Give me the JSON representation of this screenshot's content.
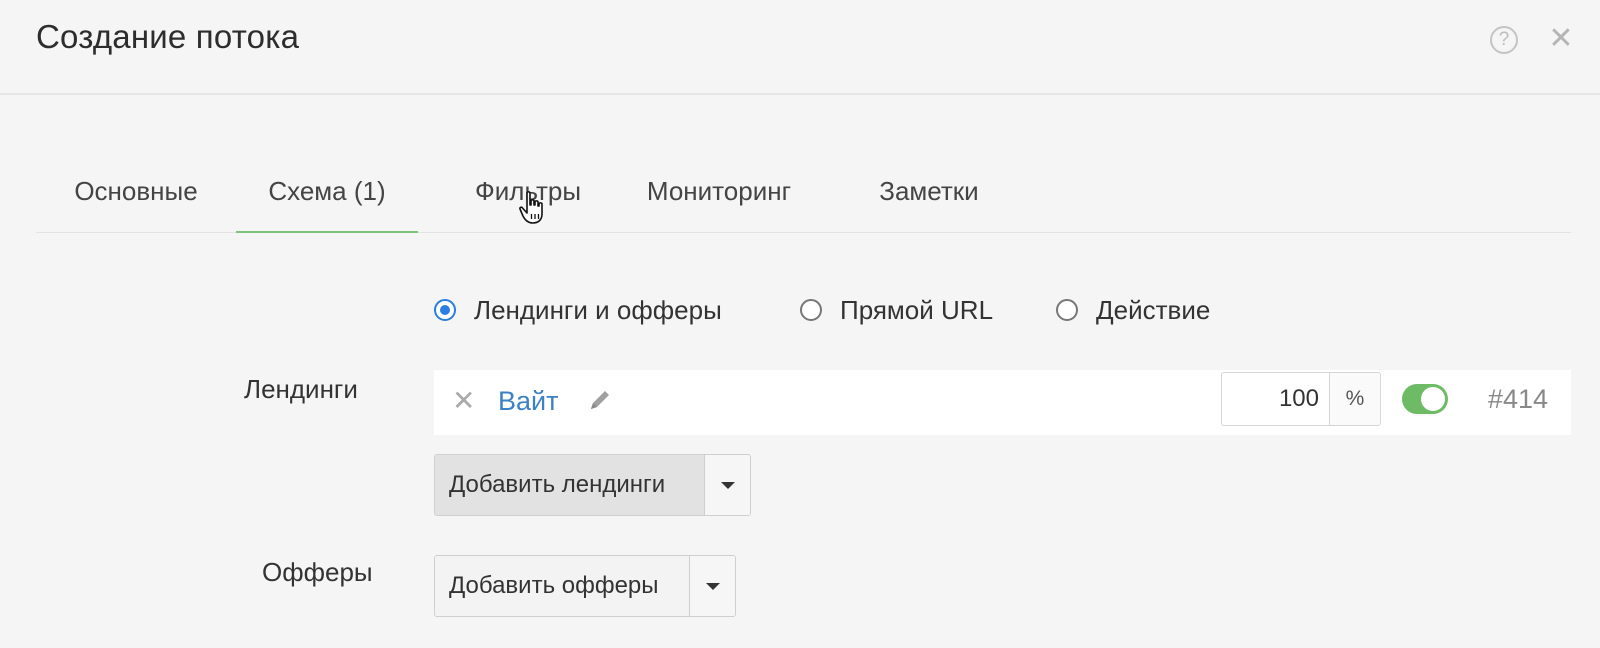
{
  "header": {
    "title": "Создание потока",
    "help_icon": "question-circle-icon",
    "help_glyph": "?",
    "close_icon": "close-icon",
    "close_glyph": "✕"
  },
  "tabs": [
    {
      "label": "Основные",
      "active": false
    },
    {
      "label": "Схема (1)",
      "active": true
    },
    {
      "label": "Фильтры",
      "active": false
    },
    {
      "label": "Мониторинг",
      "active": false
    },
    {
      "label": "Заметки",
      "active": false
    }
  ],
  "schema_type": {
    "options": [
      {
        "label": "Лендинги и офферы",
        "checked": true
      },
      {
        "label": "Прямой URL",
        "checked": false
      },
      {
        "label": "Действие",
        "checked": false
      }
    ]
  },
  "landings": {
    "label": "Лендинги",
    "items": [
      {
        "remove_glyph": "✕",
        "name": "Вайт",
        "share": "100",
        "unit": "%",
        "enabled": true,
        "id": "#414"
      }
    ],
    "add_button": "Добавить лендинги"
  },
  "offers": {
    "label": "Офферы",
    "add_button": "Добавить офферы"
  },
  "colors": {
    "accent_blue": "#2a7de1",
    "link_blue": "#3b82c4",
    "active_tab_underline": "#7cc47c",
    "toggle_on": "#6dbb64"
  }
}
